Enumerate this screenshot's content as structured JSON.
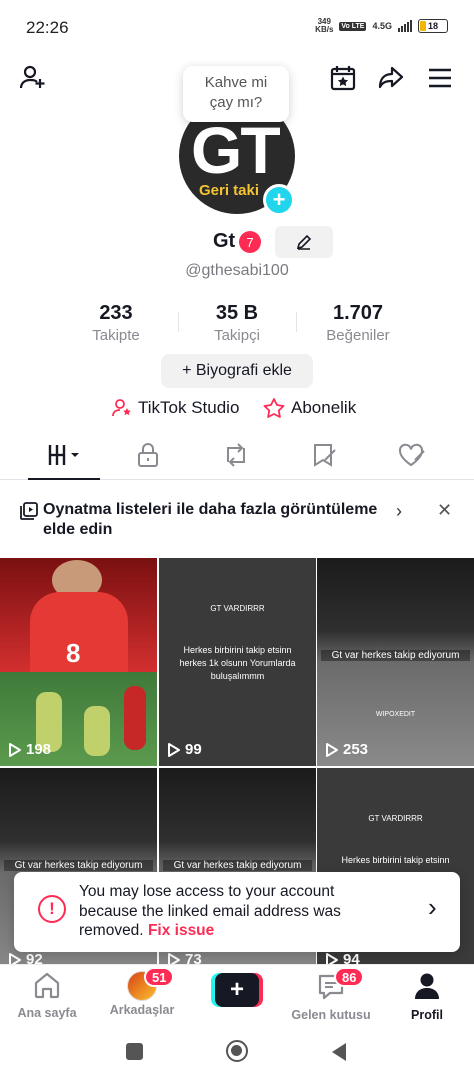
{
  "status_bar": {
    "time": "22:26",
    "speed_value": "349",
    "speed_unit": "KB/s",
    "volte": "Vo LTE",
    "network": "4.5G",
    "battery": "18"
  },
  "top_bar": {
    "icons": [
      "add-user-icon",
      "calendar-star-icon",
      "share-icon",
      "menu-icon"
    ]
  },
  "profile": {
    "avatar_text": "GT",
    "avatar_subtext": "Geri taki",
    "bubble_line1": "Kahve mi",
    "bubble_line2": "çay mı?",
    "name": "Gt",
    "badge_count": "7",
    "handle": "@gthesabi100"
  },
  "stats": [
    {
      "value": "233",
      "label": "Takipte"
    },
    {
      "value": "35 B",
      "label": "Takipçi"
    },
    {
      "value": "1.707",
      "label": "Beğeniler"
    }
  ],
  "bio_button": "+ Biyografi ekle",
  "links": {
    "studio": "TikTok Studio",
    "subscription": "Abonelik"
  },
  "promo": {
    "text": "Oynatma listeleri ile daha fazla görüntüleme elde edin"
  },
  "videos": [
    {
      "views": "198"
    },
    {
      "views": "99",
      "title": "GT VARDIRRR",
      "text": "Herkes birbirini takip etsinn herkes 1k olsunn Yorumlarda buluşalımmm"
    },
    {
      "views": "253",
      "overlay": "Gt var herkes takip ediyorum",
      "watermark": "WIPOXEDIT"
    },
    {
      "views": "92",
      "overlay": "Gt var herkes takip ediyorum"
    },
    {
      "views": "73",
      "overlay": "Gt var herkes takip ediyorum"
    },
    {
      "views": "94",
      "title": "GT VARDIRRR",
      "text": "Herkes birbirini takip etsinn"
    }
  ],
  "toast": {
    "message": "You may lose access to your account because the linked email address was removed.",
    "action": "Fix issue"
  },
  "bottom_nav": [
    {
      "label": "Ana sayfa"
    },
    {
      "label": "Arkadaşlar",
      "badge": "51"
    },
    {
      "label": ""
    },
    {
      "label": "Gelen kutusu",
      "badge": "86"
    },
    {
      "label": "Profil"
    }
  ],
  "colors": {
    "accent": "#fe2c55",
    "cyan": "#25f4ee",
    "text": "#161823"
  }
}
